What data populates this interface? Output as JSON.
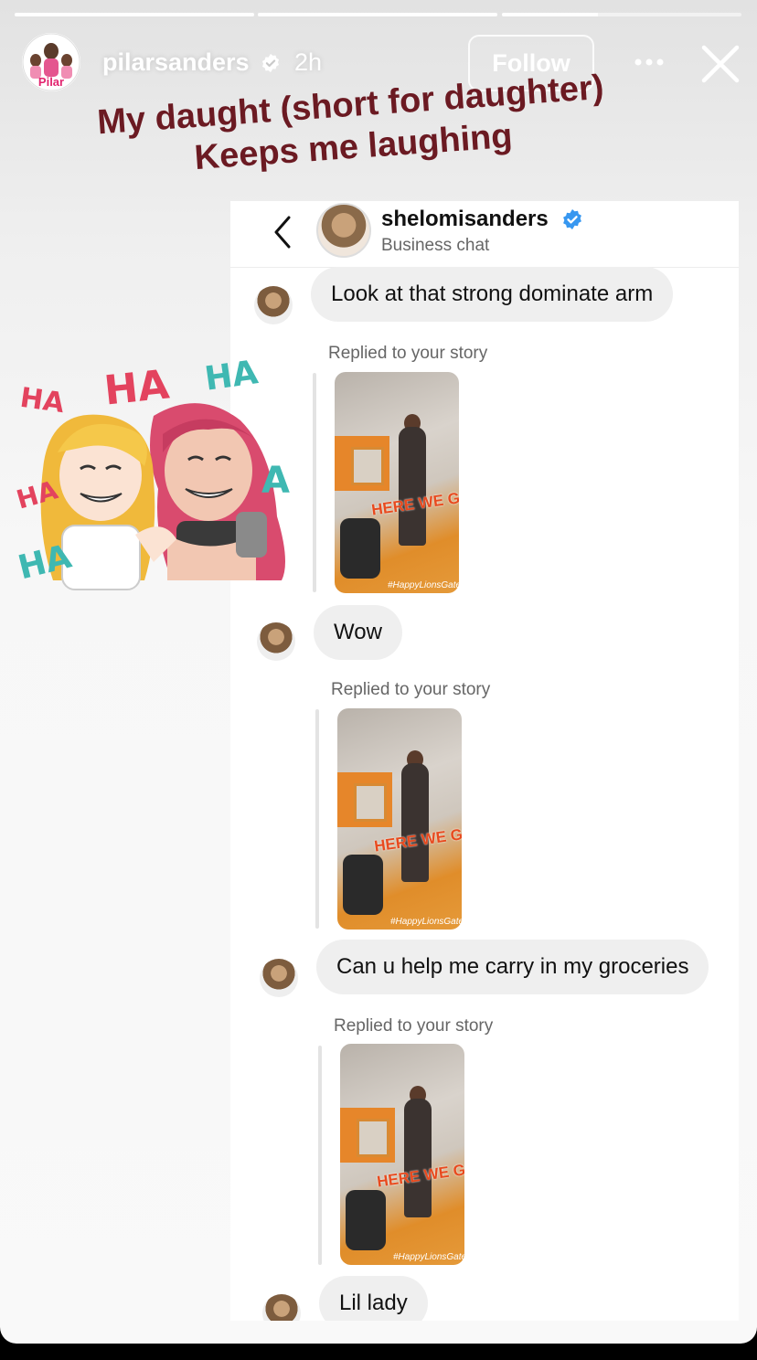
{
  "story": {
    "username": "pilarsanders",
    "time": "2h",
    "follow_label": "Follow",
    "avatar_text": "Pilar",
    "progress": [
      1.0,
      1.0,
      0.4
    ]
  },
  "caption": {
    "line1": "My daught (short for daughter)",
    "line2": "Keeps me laughing"
  },
  "sticker": {
    "texts": [
      "HA",
      "HA",
      "HA",
      "HA",
      "A",
      "HA"
    ]
  },
  "chat": {
    "name": "shelomisanders",
    "subtitle": "Business chat",
    "messages": [
      {
        "text": "Look at that strong dominate arm"
      },
      {
        "replied": "Replied to your story",
        "thumb_text": "HERE WE GO",
        "thumb_tag": "#HappyLionsGate"
      },
      {
        "text": "Wow"
      },
      {
        "replied": "Replied to your story",
        "thumb_text": "HERE WE GO",
        "thumb_tag": "#HappyLionsGate"
      },
      {
        "text": "Can u help me carry in my groceries"
      },
      {
        "replied": "Replied to your story",
        "thumb_text": "HERE WE GO",
        "thumb_tag": "#HappyLionsGate"
      },
      {
        "text": "Lil lady"
      }
    ]
  },
  "colors": {
    "caption": "#6b1a22",
    "verified": "#3797f0",
    "bubble": "#efefef"
  }
}
